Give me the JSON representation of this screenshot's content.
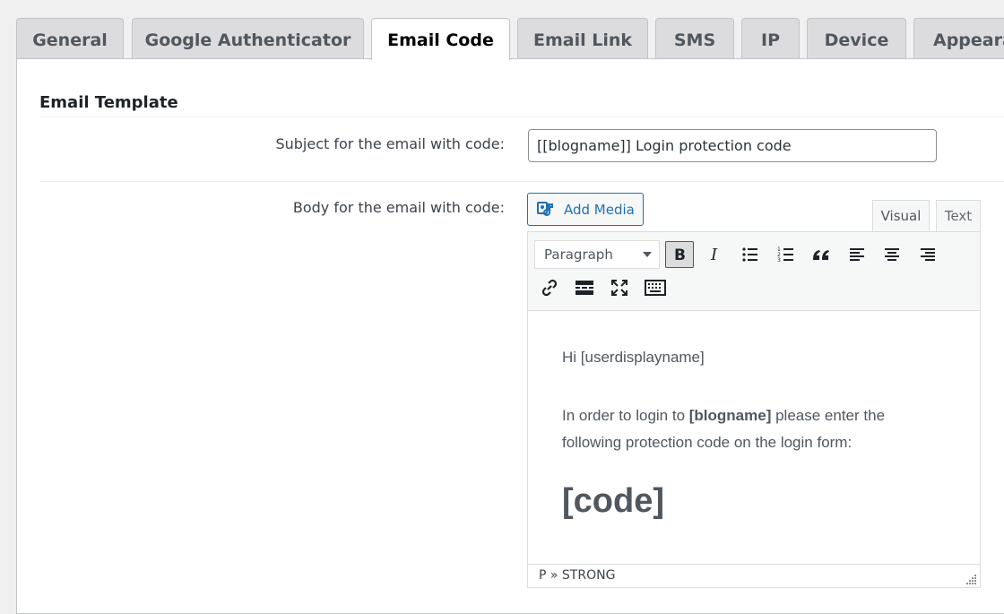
{
  "tabs": [
    "General",
    "Google Authenticator",
    "Email Code",
    "Email Link",
    "SMS",
    "IP",
    "Device",
    "Appearance"
  ],
  "active_tab": "Email Code",
  "section": {
    "title": "Email Template"
  },
  "subject": {
    "label": "Subject for the email with code:",
    "value": "[[blogname]] Login protection code"
  },
  "body": {
    "label": "Body for the email with code:",
    "add_media": "Add Media",
    "mode_tabs": {
      "visual": "Visual",
      "text": "Text"
    },
    "format_select": "Paragraph",
    "toolbar_icons": [
      "bold-icon",
      "italic-icon",
      "bullet-list-icon",
      "numbered-list-icon",
      "blockquote-icon",
      "align-left-icon",
      "align-center-icon",
      "align-right-icon",
      "link-icon",
      "read-more-icon",
      "fullscreen-icon",
      "toolbar-toggle-icon"
    ],
    "content": {
      "greeting": "Hi [userdisplayname]",
      "line1_pre": "In order to login to ",
      "line1_bold": "[blogname]",
      "line1_post": " please enter the following protection code on the login form:",
      "code": "[code]"
    },
    "status_path": "P » STRONG"
  }
}
